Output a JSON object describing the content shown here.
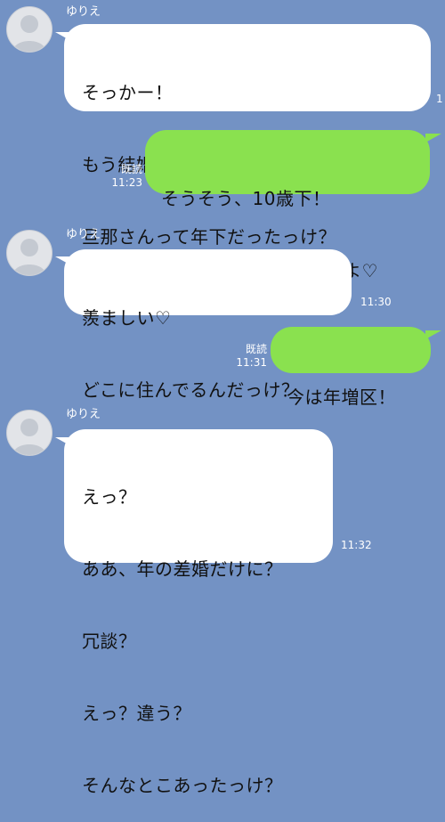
{
  "messages": [
    {
      "direction": "incoming",
      "sender": "ゆりえ",
      "lines": [
        "そっかー！",
        "もう結婚して3年になるんだねー！",
        "旦那さんって年下だったっけ？"
      ],
      "time": "1"
    },
    {
      "direction": "outgoing",
      "lines": [
        "そうそう、10歳下！",
        "若い旦那をゲットしたよ♡"
      ],
      "read_label": "既読",
      "time": "11:23"
    },
    {
      "direction": "incoming",
      "sender": "ゆりえ",
      "lines": [
        "羨ましい♡",
        "どこに住んでるんだっけ？"
      ],
      "time": "11:30"
    },
    {
      "direction": "outgoing",
      "lines": [
        "今は年増区！"
      ],
      "read_label": "既読",
      "time": "11:31"
    },
    {
      "direction": "incoming",
      "sender": "ゆりえ",
      "lines": [
        "えっ？",
        "ああ、年の差婚だけに？",
        "冗談？",
        "えっ？違う？",
        "そんなとこあったっけ？"
      ],
      "time": "11:32"
    }
  ],
  "colors": {
    "background": "#7392c4",
    "incoming_bubble": "#ffffff",
    "outgoing_bubble": "#8ae14f"
  },
  "icons": {
    "avatar": "default-user-avatar-icon"
  }
}
